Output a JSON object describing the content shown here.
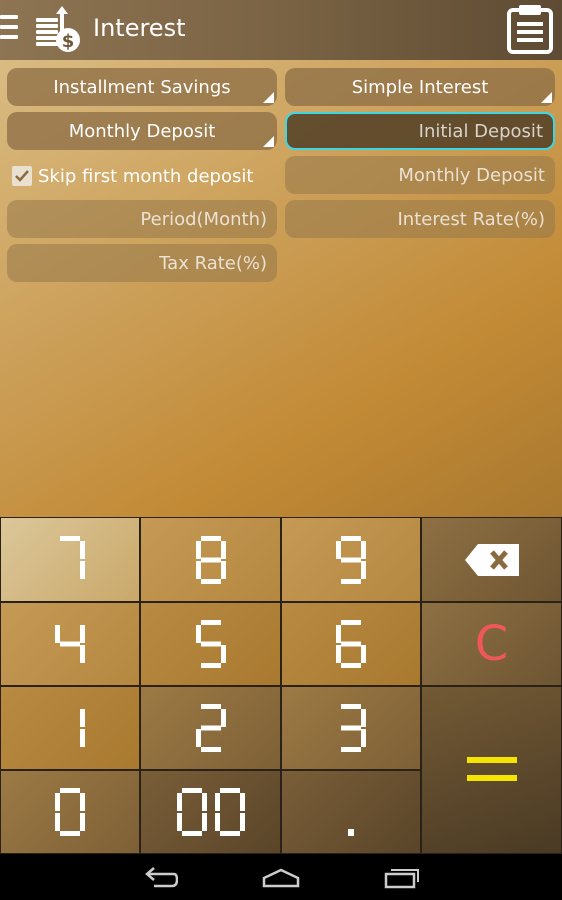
{
  "app": {
    "title": "Interest"
  },
  "icons": {
    "menu": "hamburger-menu-icon",
    "app": "coins-dollar-icon",
    "history": "clipboard-list-icon",
    "backspace": "backspace-icon",
    "nav_back": "back-arrow-icon",
    "nav_home": "home-icon",
    "nav_recents": "recent-apps-icon"
  },
  "form": {
    "savings_type": "Installment Savings",
    "interest_type": "Simple Interest",
    "deposit_type": "Monthly Deposit",
    "initial_deposit_placeholder": "Initial Deposit",
    "skip_first_month": "Skip first month deposit",
    "skip_first_month_checked": true,
    "monthly_deposit_placeholder": "Monthly Deposit",
    "period_placeholder": "Period(Month)",
    "interest_rate_placeholder": "Interest Rate(%)",
    "tax_rate_placeholder": "Tax Rate(%)"
  },
  "keypad": {
    "keys": [
      "7",
      "8",
      "9",
      "4",
      "5",
      "6",
      "1",
      "2",
      "3",
      "0",
      "00",
      "."
    ],
    "clear": "C",
    "equals": "="
  },
  "colors": {
    "active_border": "#3fd6e4",
    "clear_key": "#f0575a",
    "equals_key": "#f5e300"
  }
}
